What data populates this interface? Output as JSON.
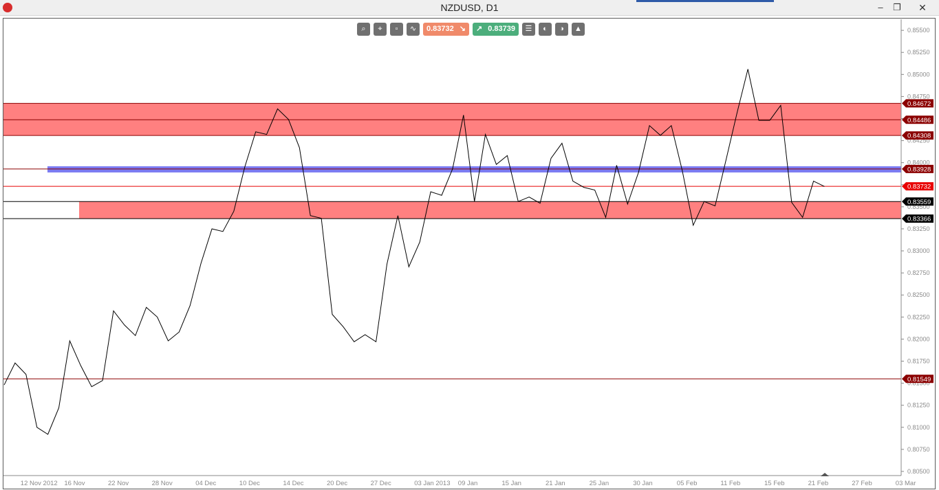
{
  "window": {
    "title": "NZDUSD, D1",
    "min_glyph": "‒",
    "restore_glyph": "❐",
    "close_glyph": "✕"
  },
  "toolbar": {
    "sell_price": "0.83732",
    "sell_arrow": "↘",
    "buy_price": "0.83739",
    "buy_arrow": "↗",
    "icons": [
      "zoom-icon",
      "crosshair-settings-icon",
      "data-window-icon",
      "chart-type-icon",
      "trade-list-icon",
      "pending-order-icon",
      "alert-icon",
      "template-icon"
    ]
  },
  "colors": {
    "zone_red": "#ff8080",
    "zone_line": "#8b0000",
    "blue_band": "#7b7bf2",
    "price_line": "#000000",
    "current_price_red": "#e80000"
  },
  "chart_data": {
    "type": "line",
    "symbol": "NZDUSD",
    "timeframe": "D1",
    "ylim": [
      0.80484,
      0.85618
    ],
    "y_ticks": [
      "0.85500",
      "0.85250",
      "0.85000",
      "0.84750",
      "0.84500",
      "0.84250",
      "0.84000",
      "0.83750",
      "0.83500",
      "0.83250",
      "0.83000",
      "0.82750",
      "0.82500",
      "0.82250",
      "0.82000",
      "0.81750",
      "0.81500",
      "0.81250",
      "0.81000",
      "0.80750",
      "0.80500"
    ],
    "x_ticks": [
      {
        "label": "12 Nov 2012",
        "idx": 2
      },
      {
        "label": "16 Nov",
        "idx": 6
      },
      {
        "label": "22 Nov",
        "idx": 10
      },
      {
        "label": "28 Nov",
        "idx": 14
      },
      {
        "label": "04 Dec",
        "idx": 18
      },
      {
        "label": "10 Dec",
        "idx": 22
      },
      {
        "label": "14 Dec",
        "idx": 26
      },
      {
        "label": "20 Dec",
        "idx": 30
      },
      {
        "label": "27 Dec",
        "idx": 34
      },
      {
        "label": "03 Jan 2013",
        "idx": 38
      },
      {
        "label": "09 Jan",
        "idx": 42
      },
      {
        "label": "15 Jan",
        "idx": 46
      },
      {
        "label": "21 Jan",
        "idx": 50
      },
      {
        "label": "25 Jan",
        "idx": 54
      },
      {
        "label": "30 Jan",
        "idx": 58
      },
      {
        "label": "05 Feb",
        "idx": 62
      },
      {
        "label": "11 Feb",
        "idx": 66
      },
      {
        "label": "15 Feb",
        "idx": 70
      },
      {
        "label": "21 Feb",
        "idx": 74
      },
      {
        "label": "27 Feb",
        "idx": 78
      },
      {
        "label": "03 Mar",
        "idx": 82
      }
    ],
    "series": [
      {
        "values": [
          0.8148,
          0.8173,
          0.816,
          0.81,
          0.8092,
          0.8122,
          0.8198,
          0.817,
          0.8146,
          0.8153,
          0.8232,
          0.8216,
          0.8204,
          0.8236,
          0.8225,
          0.8198,
          0.8208,
          0.8238,
          0.8286,
          0.8325,
          0.8322,
          0.8345,
          0.8395,
          0.8435,
          0.8432,
          0.8461,
          0.8449,
          0.8417,
          0.834,
          0.8337,
          0.8228,
          0.8214,
          0.8197,
          0.8205,
          0.8197,
          0.8285,
          0.834,
          0.8282,
          0.831,
          0.8367,
          0.8363,
          0.8393,
          0.8454,
          0.8356,
          0.8432,
          0.8398,
          0.8408,
          0.8356,
          0.8361,
          0.8354,
          0.8405,
          0.8422,
          0.8379,
          0.8372,
          0.8369,
          0.8338,
          0.8397,
          0.8353,
          0.8389,
          0.8442,
          0.8431,
          0.8442,
          0.8391,
          0.8329,
          0.8356,
          0.8351,
          0.8403,
          0.8456,
          0.8506,
          0.8448,
          0.8448,
          0.8465,
          0.8355,
          0.8338,
          0.8379,
          0.8373
        ]
      }
    ],
    "levels": [
      {
        "value": 0.84672,
        "label": "0.84672",
        "kind": "resistance"
      },
      {
        "value": 0.84486,
        "label": "0.84486",
        "kind": "resistance"
      },
      {
        "value": 0.84308,
        "label": "0.84308",
        "kind": "resistance"
      },
      {
        "value": 0.83928,
        "label": "0.83928",
        "kind": "pivot"
      },
      {
        "value": 0.83732,
        "label": "0.83732",
        "kind": "current"
      },
      {
        "value": 0.83559,
        "label": "0.83559",
        "kind": "support"
      },
      {
        "value": 0.83366,
        "label": "0.83366",
        "kind": "support"
      },
      {
        "value": 0.81549,
        "label": "0.81549",
        "kind": "level"
      }
    ],
    "zones": [
      {
        "from": 0.84308,
        "to": 0.84672,
        "color": "#ff8080"
      },
      {
        "from": 0.83366,
        "to": 0.83559,
        "color": "#ff8080"
      }
    ],
    "blue_band": {
      "value": 0.83928
    }
  }
}
